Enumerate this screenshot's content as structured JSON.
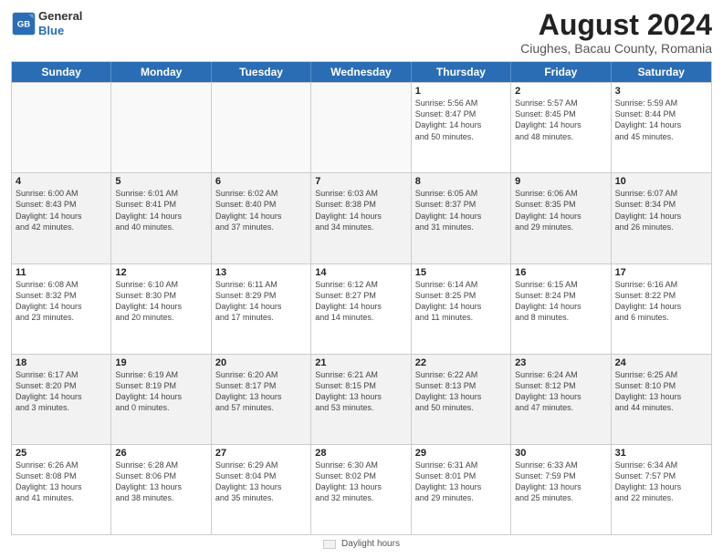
{
  "logo": {
    "line1": "General",
    "line2": "Blue"
  },
  "title": "August 2024",
  "subtitle": "Ciughes, Bacau County, Romania",
  "days_of_week": [
    "Sunday",
    "Monday",
    "Tuesday",
    "Wednesday",
    "Thursday",
    "Friday",
    "Saturday"
  ],
  "footer_label": "Daylight hours",
  "weeks": [
    [
      {
        "day": "",
        "info": "",
        "empty": true
      },
      {
        "day": "",
        "info": "",
        "empty": true
      },
      {
        "day": "",
        "info": "",
        "empty": true
      },
      {
        "day": "",
        "info": "",
        "empty": true
      },
      {
        "day": "1",
        "info": "Sunrise: 5:56 AM\nSunset: 8:47 PM\nDaylight: 14 hours\nand 50 minutes.",
        "empty": false
      },
      {
        "day": "2",
        "info": "Sunrise: 5:57 AM\nSunset: 8:45 PM\nDaylight: 14 hours\nand 48 minutes.",
        "empty": false
      },
      {
        "day": "3",
        "info": "Sunrise: 5:59 AM\nSunset: 8:44 PM\nDaylight: 14 hours\nand 45 minutes.",
        "empty": false
      }
    ],
    [
      {
        "day": "4",
        "info": "Sunrise: 6:00 AM\nSunset: 8:43 PM\nDaylight: 14 hours\nand 42 minutes.",
        "empty": false
      },
      {
        "day": "5",
        "info": "Sunrise: 6:01 AM\nSunset: 8:41 PM\nDaylight: 14 hours\nand 40 minutes.",
        "empty": false
      },
      {
        "day": "6",
        "info": "Sunrise: 6:02 AM\nSunset: 8:40 PM\nDaylight: 14 hours\nand 37 minutes.",
        "empty": false
      },
      {
        "day": "7",
        "info": "Sunrise: 6:03 AM\nSunset: 8:38 PM\nDaylight: 14 hours\nand 34 minutes.",
        "empty": false
      },
      {
        "day": "8",
        "info": "Sunrise: 6:05 AM\nSunset: 8:37 PM\nDaylight: 14 hours\nand 31 minutes.",
        "empty": false
      },
      {
        "day": "9",
        "info": "Sunrise: 6:06 AM\nSunset: 8:35 PM\nDaylight: 14 hours\nand 29 minutes.",
        "empty": false
      },
      {
        "day": "10",
        "info": "Sunrise: 6:07 AM\nSunset: 8:34 PM\nDaylight: 14 hours\nand 26 minutes.",
        "empty": false
      }
    ],
    [
      {
        "day": "11",
        "info": "Sunrise: 6:08 AM\nSunset: 8:32 PM\nDaylight: 14 hours\nand 23 minutes.",
        "empty": false
      },
      {
        "day": "12",
        "info": "Sunrise: 6:10 AM\nSunset: 8:30 PM\nDaylight: 14 hours\nand 20 minutes.",
        "empty": false
      },
      {
        "day": "13",
        "info": "Sunrise: 6:11 AM\nSunset: 8:29 PM\nDaylight: 14 hours\nand 17 minutes.",
        "empty": false
      },
      {
        "day": "14",
        "info": "Sunrise: 6:12 AM\nSunset: 8:27 PM\nDaylight: 14 hours\nand 14 minutes.",
        "empty": false
      },
      {
        "day": "15",
        "info": "Sunrise: 6:14 AM\nSunset: 8:25 PM\nDaylight: 14 hours\nand 11 minutes.",
        "empty": false
      },
      {
        "day": "16",
        "info": "Sunrise: 6:15 AM\nSunset: 8:24 PM\nDaylight: 14 hours\nand 8 minutes.",
        "empty": false
      },
      {
        "day": "17",
        "info": "Sunrise: 6:16 AM\nSunset: 8:22 PM\nDaylight: 14 hours\nand 6 minutes.",
        "empty": false
      }
    ],
    [
      {
        "day": "18",
        "info": "Sunrise: 6:17 AM\nSunset: 8:20 PM\nDaylight: 14 hours\nand 3 minutes.",
        "empty": false
      },
      {
        "day": "19",
        "info": "Sunrise: 6:19 AM\nSunset: 8:19 PM\nDaylight: 14 hours\nand 0 minutes.",
        "empty": false
      },
      {
        "day": "20",
        "info": "Sunrise: 6:20 AM\nSunset: 8:17 PM\nDaylight: 13 hours\nand 57 minutes.",
        "empty": false
      },
      {
        "day": "21",
        "info": "Sunrise: 6:21 AM\nSunset: 8:15 PM\nDaylight: 13 hours\nand 53 minutes.",
        "empty": false
      },
      {
        "day": "22",
        "info": "Sunrise: 6:22 AM\nSunset: 8:13 PM\nDaylight: 13 hours\nand 50 minutes.",
        "empty": false
      },
      {
        "day": "23",
        "info": "Sunrise: 6:24 AM\nSunset: 8:12 PM\nDaylight: 13 hours\nand 47 minutes.",
        "empty": false
      },
      {
        "day": "24",
        "info": "Sunrise: 6:25 AM\nSunset: 8:10 PM\nDaylight: 13 hours\nand 44 minutes.",
        "empty": false
      }
    ],
    [
      {
        "day": "25",
        "info": "Sunrise: 6:26 AM\nSunset: 8:08 PM\nDaylight: 13 hours\nand 41 minutes.",
        "empty": false
      },
      {
        "day": "26",
        "info": "Sunrise: 6:28 AM\nSunset: 8:06 PM\nDaylight: 13 hours\nand 38 minutes.",
        "empty": false
      },
      {
        "day": "27",
        "info": "Sunrise: 6:29 AM\nSunset: 8:04 PM\nDaylight: 13 hours\nand 35 minutes.",
        "empty": false
      },
      {
        "day": "28",
        "info": "Sunrise: 6:30 AM\nSunset: 8:02 PM\nDaylight: 13 hours\nand 32 minutes.",
        "empty": false
      },
      {
        "day": "29",
        "info": "Sunrise: 6:31 AM\nSunset: 8:01 PM\nDaylight: 13 hours\nand 29 minutes.",
        "empty": false
      },
      {
        "day": "30",
        "info": "Sunrise: 6:33 AM\nSunset: 7:59 PM\nDaylight: 13 hours\nand 25 minutes.",
        "empty": false
      },
      {
        "day": "31",
        "info": "Sunrise: 6:34 AM\nSunset: 7:57 PM\nDaylight: 13 hours\nand 22 minutes.",
        "empty": false
      }
    ]
  ]
}
